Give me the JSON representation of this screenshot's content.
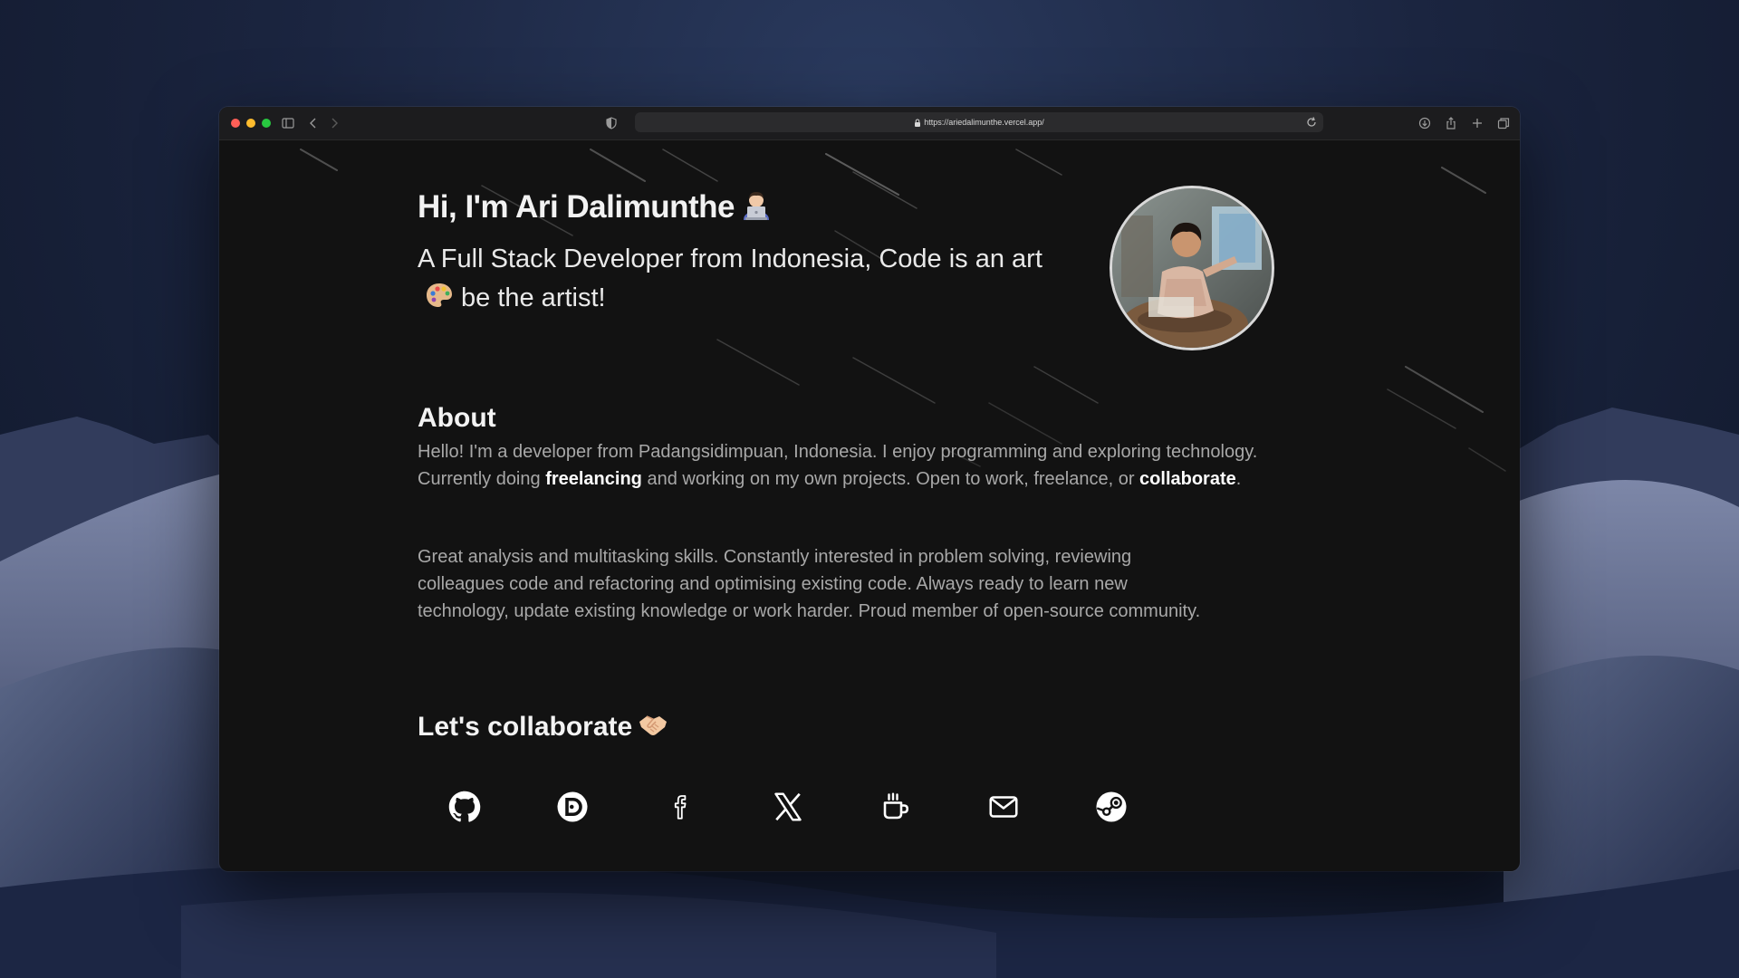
{
  "browser": {
    "url": "https://ariedalimunthe.vercel.app/"
  },
  "hero": {
    "title": "Hi, I'm Ari Dalimunthe",
    "title_emoji": "technologist-emoji",
    "subtitle_part1": "A Full Stack Developer from Indonesia, Code is an art",
    "subtitle_emoji": "palette-emoji",
    "subtitle_part2": "be the artist!",
    "avatar": "profile-photo"
  },
  "about": {
    "title": "About",
    "p1_a": "Hello! I'm a developer from Padangsidimpuan, Indonesia. I enjoy programming and exploring technology. Currently doing ",
    "p1_bold1": "freelancing",
    "p1_b": " and working on my own projects. Open to work, freelance, or ",
    "p1_bold2": "collaborate",
    "p1_c": ".",
    "p2": "Great analysis and multitasking skills. Constantly interested in problem solving, reviewing colleagues code and refactoring and optimising existing code. Always ready to learn new technology, update existing knowledge or work harder. Proud member of open-source community."
  },
  "collaborate": {
    "title": "Let's collaborate",
    "title_emoji": "handshake-emoji",
    "socials": [
      {
        "icon": "github-icon"
      },
      {
        "icon": "discord-icon"
      },
      {
        "icon": "facebook-icon"
      },
      {
        "icon": "x-icon"
      },
      {
        "icon": "coffee-icon"
      },
      {
        "icon": "mail-icon"
      },
      {
        "icon": "steam-icon"
      }
    ]
  },
  "colors": {
    "page_bg": "#121212",
    "heading": "#f2f2f2",
    "body_text": "#a8a8a8",
    "emphasis": "#ffffff"
  }
}
